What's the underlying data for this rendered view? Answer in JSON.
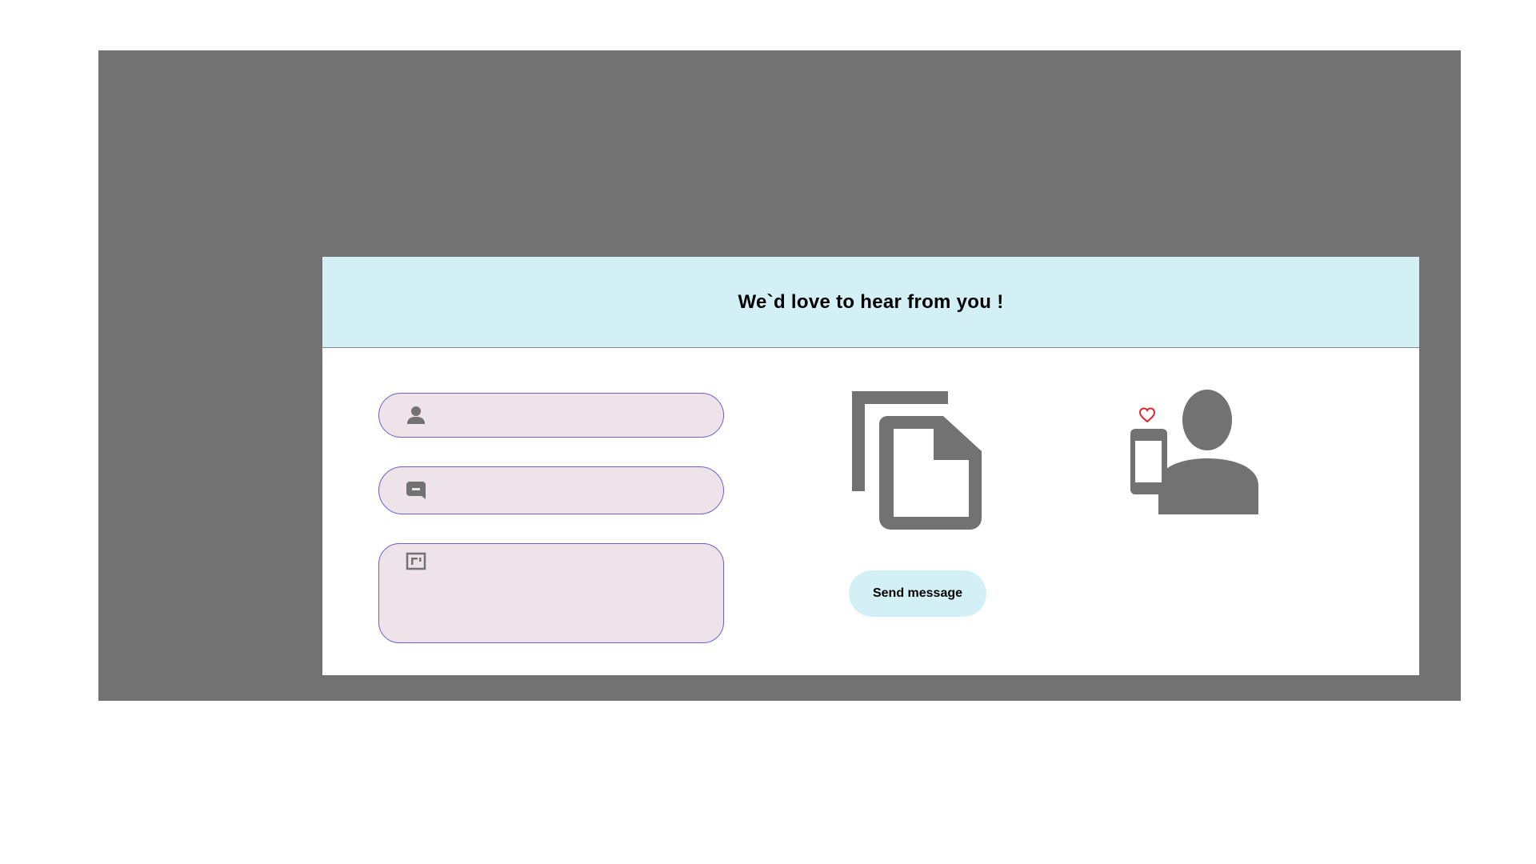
{
  "header": {
    "title": "We`d love to hear from you !"
  },
  "form": {
    "name_field": {
      "value": "",
      "placeholder": "",
      "icon": "person-icon"
    },
    "email_field": {
      "value": "",
      "placeholder": "",
      "icon": "chat-bubble-icon"
    },
    "message_field": {
      "value": "",
      "placeholder": "",
      "icon": "message-box-icon"
    }
  },
  "actions": {
    "send_label": "Send message"
  },
  "illustrations": {
    "documents": "documents-icon",
    "person": "person-with-phone-icon",
    "heart": "heart-icon"
  },
  "colors": {
    "backdrop": "#727272",
    "header_bg": "#d3f0f7",
    "field_bg": "#ede3e8",
    "field_border": "#6b5fd6",
    "icon_gray": "#727272",
    "heart": "#e0262b",
    "button_bg": "#d3f0f7"
  }
}
